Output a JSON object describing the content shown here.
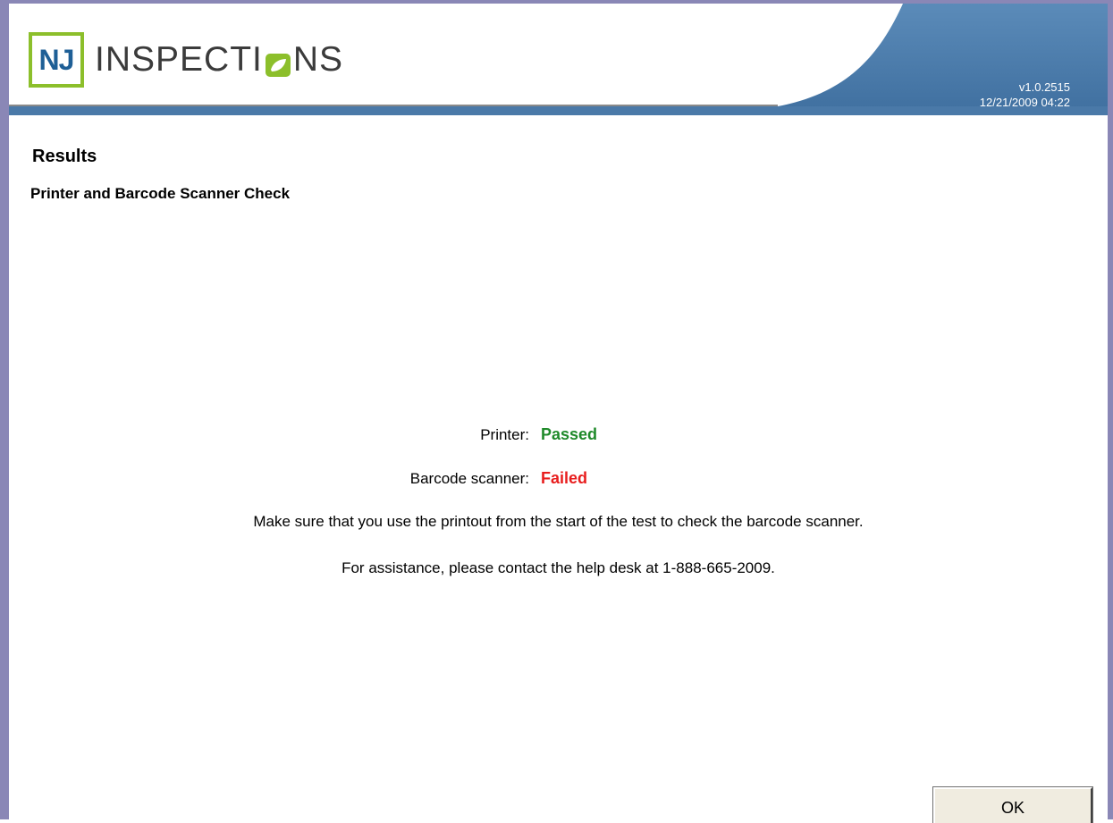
{
  "app": {
    "logo_nj": "NJ",
    "logo_text_left": "INSPECTI",
    "logo_text_right": "NS",
    "version": "v1.0.2515",
    "datetime": "12/21/2009 04:22"
  },
  "page": {
    "title": "Results",
    "section_title": "Printer and Barcode Scanner Check"
  },
  "results": {
    "printer_label": "Printer:",
    "printer_status": "Passed",
    "scanner_label": "Barcode scanner:",
    "scanner_status": "Failed"
  },
  "messages": {
    "instruction": "Make sure that you use the printout from the start of the test to check the barcode scanner.",
    "assistance": "For assistance, please contact the help desk at 1-888-665-2009."
  },
  "buttons": {
    "ok_label": "OK"
  },
  "colors": {
    "header_blue": "#4f7fae",
    "logo_green": "#8cbf2b",
    "logo_blue": "#1e5f96",
    "passed": "#1f8a2a",
    "failed": "#e81d1d",
    "frame": "#8a87b6"
  }
}
